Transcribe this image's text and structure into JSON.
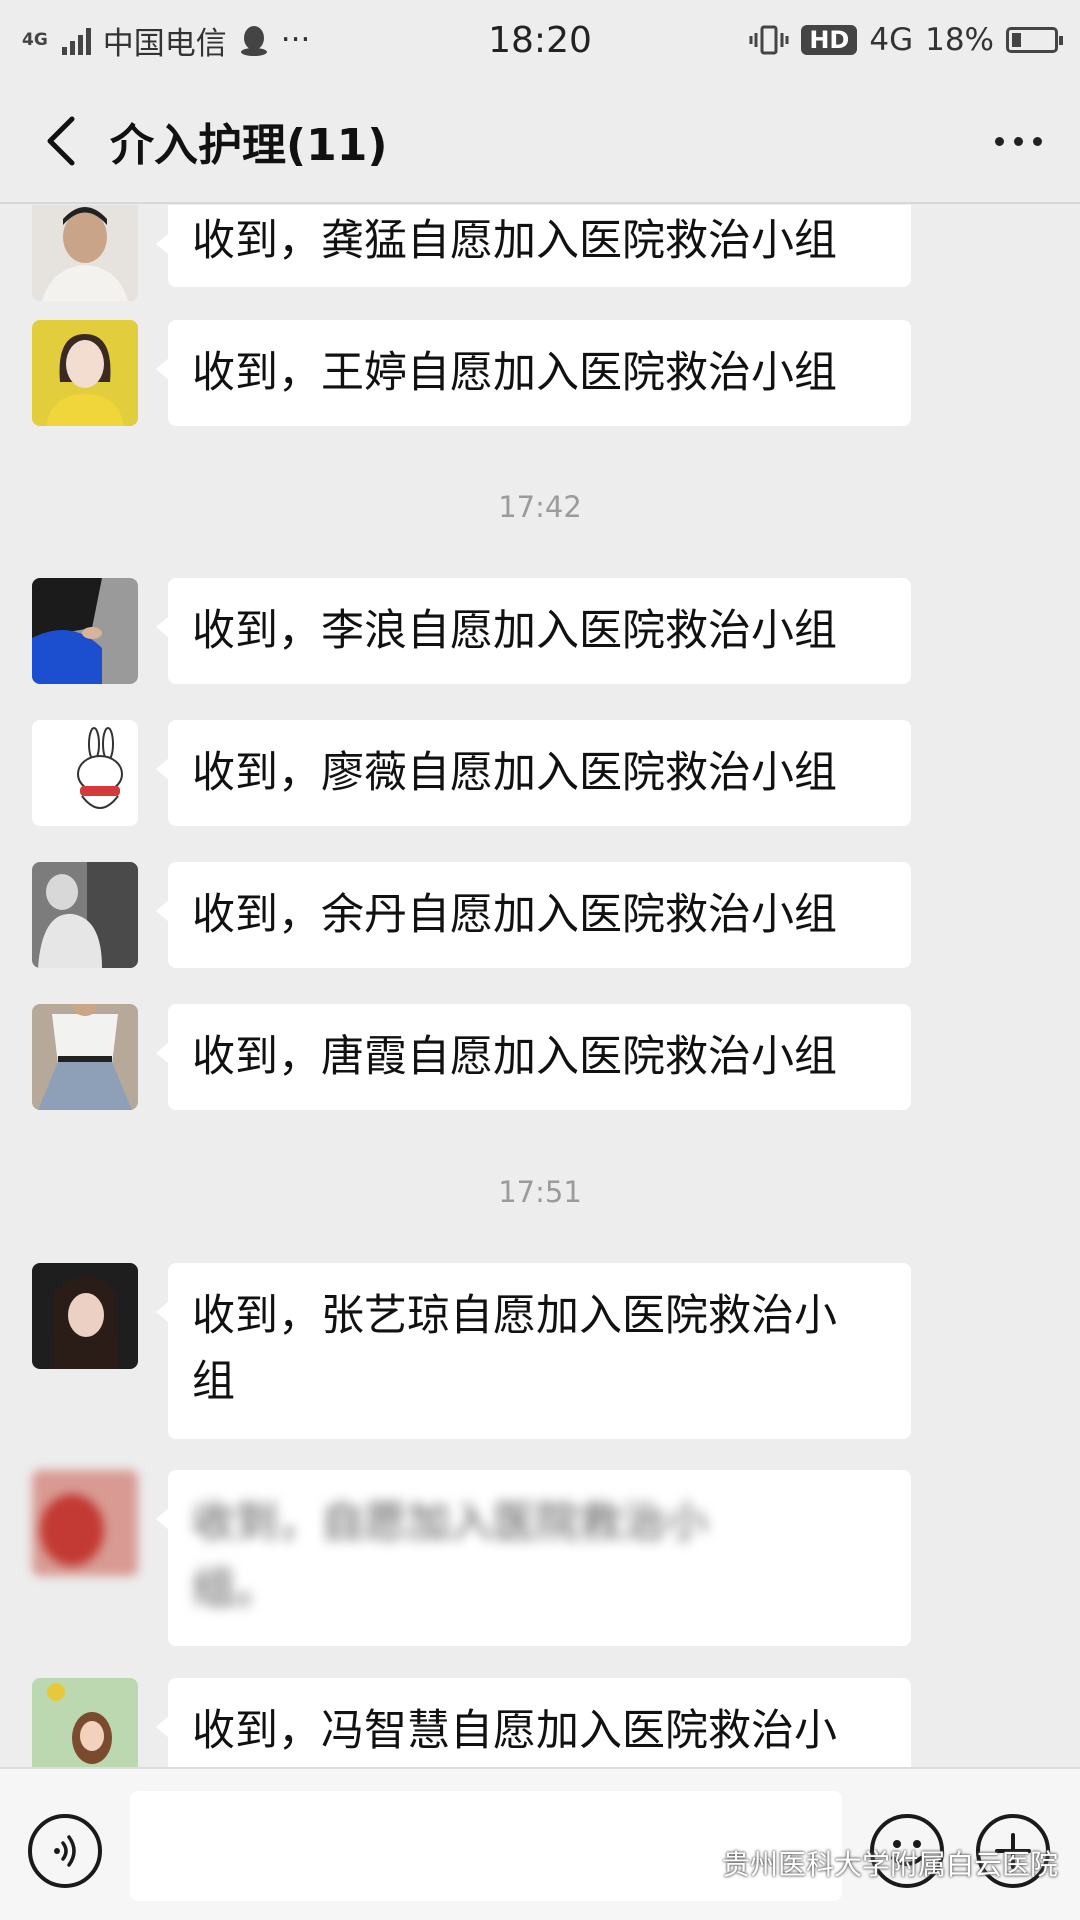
{
  "status_bar": {
    "network_small": "4G",
    "carrier": "中国电信",
    "extra": "···",
    "time": "18:20",
    "hd": "HD",
    "network": "4G",
    "battery": "18%"
  },
  "header": {
    "title": "介入护理(11)"
  },
  "messages": [
    {
      "text": "收到，龚猛自愿加入医院救治小组"
    },
    {
      "text": "收到，王婷自愿加入医院救治小组"
    },
    {
      "time": "17:42"
    },
    {
      "text": "收到，李浪自愿加入医院救治小组"
    },
    {
      "text": "收到，廖薇自愿加入医院救治小组"
    },
    {
      "text": "收到，余丹自愿加入医院救治小组"
    },
    {
      "text": "收到，唐霞自愿加入医院救治小组"
    },
    {
      "time": "17:51"
    },
    {
      "text_line1": "收到，张艺琼自愿加入医院救治小",
      "text_line2": "组"
    },
    {
      "blurred_line1": "收到，自愿加入医院救治小",
      "blurred_line2": "组。"
    },
    {
      "text": "收到，冯智慧自愿加入医院救治小"
    }
  ],
  "input_bar": {
    "placeholder": "",
    "watermark": "贵州医科大学附属白云医院"
  },
  "colors": {
    "background": "#ededed",
    "bubble": "#ffffff",
    "time_text": "#9b9b9b"
  }
}
